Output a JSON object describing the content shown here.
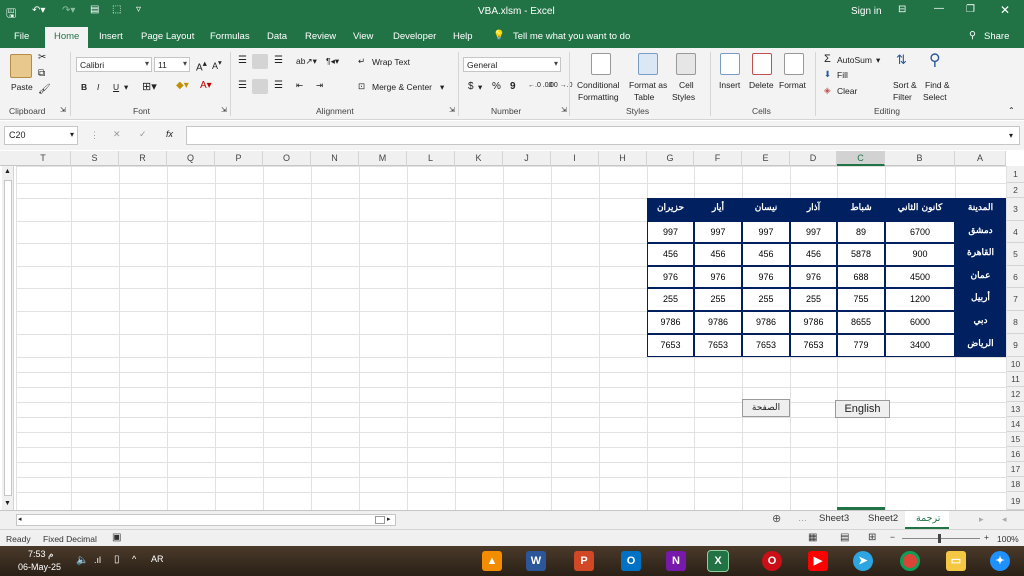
{
  "window": {
    "title": "VBA.xlsm  -  Excel",
    "signin": "Sign in"
  },
  "tabs": [
    "File",
    "Home",
    "Insert",
    "Page Layout",
    "Formulas",
    "Data",
    "Review",
    "View",
    "Developer",
    "Help"
  ],
  "tell_me": "Tell me what you want to do",
  "share": "Share",
  "ribbon": {
    "clipboard": {
      "paste": "Paste",
      "label": "Clipboard"
    },
    "font": {
      "name": "Calibri",
      "size": "11",
      "bold": "B",
      "italic": "I",
      "underline": "U",
      "label": "Font"
    },
    "alignment": {
      "wrap": "Wrap Text",
      "merge": "Merge & Center",
      "label": "Alignment"
    },
    "number": {
      "format": "General",
      "currency": "$",
      "percent": "%",
      "comma": "9",
      "inc": "←.0 .00",
      "dec": ".00 →.0",
      "label": "Number"
    },
    "styles": {
      "cond1": "Conditional",
      "cond2": "Formatting",
      "fmt1": "Format as",
      "fmt2": "Table",
      "cell1": "Cell",
      "cell2": "Styles",
      "label": "Styles"
    },
    "cells": {
      "insert": "Insert",
      "delete": "Delete",
      "format": "Format",
      "label": "Cells"
    },
    "editing": {
      "autosum": "AutoSum",
      "fill": "Fill",
      "clear": "Clear",
      "sort1": "Sort &",
      "sort2": "Filter",
      "find1": "Find &",
      "find2": "Select",
      "label": "Editing"
    }
  },
  "formula_bar": {
    "name_box": "C20",
    "fx": "fx",
    "value": ""
  },
  "columns": [
    "T",
    "S",
    "R",
    "Q",
    "P",
    "O",
    "N",
    "M",
    "L",
    "K",
    "J",
    "I",
    "H",
    "G",
    "F",
    "E",
    "D",
    "C",
    "B",
    "A"
  ],
  "rows": [
    "1",
    "2",
    "3",
    "4",
    "5",
    "6",
    "7",
    "8",
    "9",
    "10",
    "11",
    "12",
    "13",
    "14",
    "15",
    "16",
    "17",
    "18",
    "19"
  ],
  "table": {
    "headers": [
      "المدينة",
      "كانون الثاني",
      "شباط",
      "آذار",
      "نيسان",
      "أيار",
      "حزيران"
    ],
    "rows": [
      {
        "city": "دمشق",
        "values": [
          "6700",
          "89",
          "997",
          "997",
          "997",
          "997"
        ]
      },
      {
        "city": "القاهرة",
        "values": [
          "900",
          "5878",
          "456",
          "456",
          "456",
          "456"
        ]
      },
      {
        "city": "عمان",
        "values": [
          "4500",
          "688",
          "976",
          "976",
          "976",
          "976"
        ]
      },
      {
        "city": "أربيل",
        "values": [
          "1200",
          "755",
          "255",
          "255",
          "255",
          "255"
        ]
      },
      {
        "city": "دبي",
        "values": [
          "6000",
          "8655",
          "9786",
          "9786",
          "9786",
          "9786"
        ]
      },
      {
        "city": "الرياض",
        "values": [
          "3400",
          "779",
          "7653",
          "7653",
          "7653",
          "7653"
        ]
      }
    ]
  },
  "buttons": {
    "page": "الصفحة",
    "english": "English"
  },
  "sheets": [
    "Sheet3",
    "Sheet2",
    "ترجمة"
  ],
  "status": {
    "ready": "Ready",
    "fixed": "Fixed Decimal",
    "zoom": "100%"
  },
  "taskbar": {
    "time": "7:53 م",
    "date": "06-May-25",
    "lang": "AR"
  }
}
